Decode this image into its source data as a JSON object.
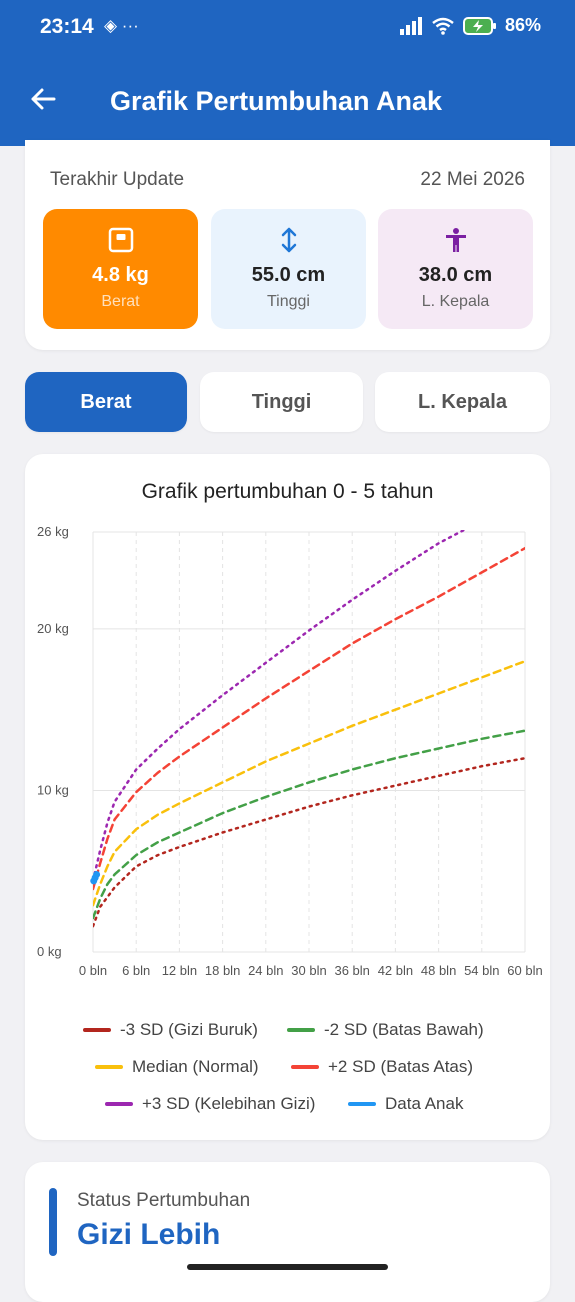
{
  "status_bar": {
    "time": "23:14",
    "left_icons": "◈ ···",
    "battery": "86%"
  },
  "app_bar": {
    "title": "Grafik Pertumbuhan Anak"
  },
  "summary": {
    "update_label": "Terakhir Update",
    "update_date": "22 Mei 2026",
    "metrics": [
      {
        "value": "4.8 kg",
        "label": "Berat",
        "icon": "scale-icon"
      },
      {
        "value": "55.0 cm",
        "label": "Tinggi",
        "icon": "vertical-arrows-icon"
      },
      {
        "value": "38.0 cm",
        "label": "L. Kepala",
        "icon": "person-icon"
      }
    ]
  },
  "tabs": [
    {
      "label": "Berat",
      "active": true
    },
    {
      "label": "Tinggi",
      "active": false
    },
    {
      "label": "L. Kepala",
      "active": false
    }
  ],
  "chart_title": "Grafik pertumbuhan 0 - 5 tahun",
  "chart_data": {
    "type": "line",
    "title": "Grafik pertumbuhan 0 - 5 tahun",
    "x_ticks": [
      0,
      6,
      12,
      18,
      24,
      30,
      36,
      42,
      48,
      54,
      60
    ],
    "x_tick_labels": [
      "0 bln",
      "6 bln",
      "12 bln",
      "18 bln",
      "24 bln",
      "30 bln",
      "36 bln",
      "42 bln",
      "48 bln",
      "54 bln",
      "60 bln"
    ],
    "y_ticks": [
      0,
      10,
      20,
      26
    ],
    "y_tick_labels": [
      "0 kg",
      "10 kg",
      "20 kg",
      "26 kg"
    ],
    "xlim": [
      0,
      60
    ],
    "ylim": [
      0,
      26
    ],
    "grid": true,
    "series": [
      {
        "name": "-3 SD (Gizi Buruk)",
        "color": "#b3261e",
        "style": "dotted",
        "x": [
          0,
          1,
          2,
          3,
          6,
          9,
          12,
          18,
          24,
          30,
          36,
          42,
          48,
          54,
          60
        ],
        "y": [
          1.6,
          2.8,
          3.4,
          4.0,
          5.3,
          6.0,
          6.5,
          7.4,
          8.2,
          9.0,
          9.7,
          10.3,
          10.9,
          11.5,
          12.0
        ]
      },
      {
        "name": "-2 SD (Batas Bawah)",
        "color": "#43a047",
        "style": "dashed",
        "x": [
          0,
          1,
          2,
          3,
          6,
          9,
          12,
          18,
          24,
          30,
          36,
          42,
          48,
          54,
          60
        ],
        "y": [
          2.1,
          3.3,
          4.2,
          4.8,
          6.0,
          6.8,
          7.4,
          8.6,
          9.6,
          10.5,
          11.3,
          12.0,
          12.6,
          13.2,
          13.7
        ]
      },
      {
        "name": "Median (Normal)",
        "color": "#f9c00c",
        "style": "dashed",
        "x": [
          0,
          1,
          2,
          3,
          6,
          9,
          12,
          18,
          24,
          30,
          36,
          42,
          48,
          54,
          60
        ],
        "y": [
          2.9,
          4.2,
          5.3,
          6.2,
          7.6,
          8.5,
          9.2,
          10.5,
          11.8,
          12.9,
          14.0,
          15.0,
          16.0,
          17.0,
          18.0
        ]
      },
      {
        "name": "+2 SD (Batas Atas)",
        "color": "#f44336",
        "style": "dashed",
        "x": [
          0,
          1,
          2,
          3,
          6,
          9,
          12,
          18,
          24,
          30,
          36,
          42,
          48,
          54,
          60
        ],
        "y": [
          3.9,
          5.5,
          7.0,
          8.2,
          9.9,
          11.1,
          12.1,
          13.9,
          15.7,
          17.4,
          19.1,
          20.6,
          22.0,
          23.5,
          25.0
        ]
      },
      {
        "name": "+3 SD (Kelebihan Gizi)",
        "color": "#9c27b0",
        "style": "dotted",
        "x": [
          0,
          1,
          2,
          3,
          6,
          9,
          12,
          18,
          24,
          30,
          36,
          42,
          48,
          54
        ],
        "y": [
          4.4,
          6.3,
          8.0,
          9.3,
          11.3,
          12.6,
          13.8,
          15.9,
          17.9,
          19.9,
          21.8,
          23.6,
          25.3,
          26.7
        ]
      },
      {
        "name": "Data Anak",
        "color": "#2196f3",
        "style": "solid",
        "x": [
          0.1,
          0.3,
          0.5
        ],
        "y": [
          4.4,
          4.6,
          4.8
        ]
      }
    ]
  },
  "status": {
    "label": "Status Pertumbuhan",
    "value": "Gizi Lebih"
  }
}
